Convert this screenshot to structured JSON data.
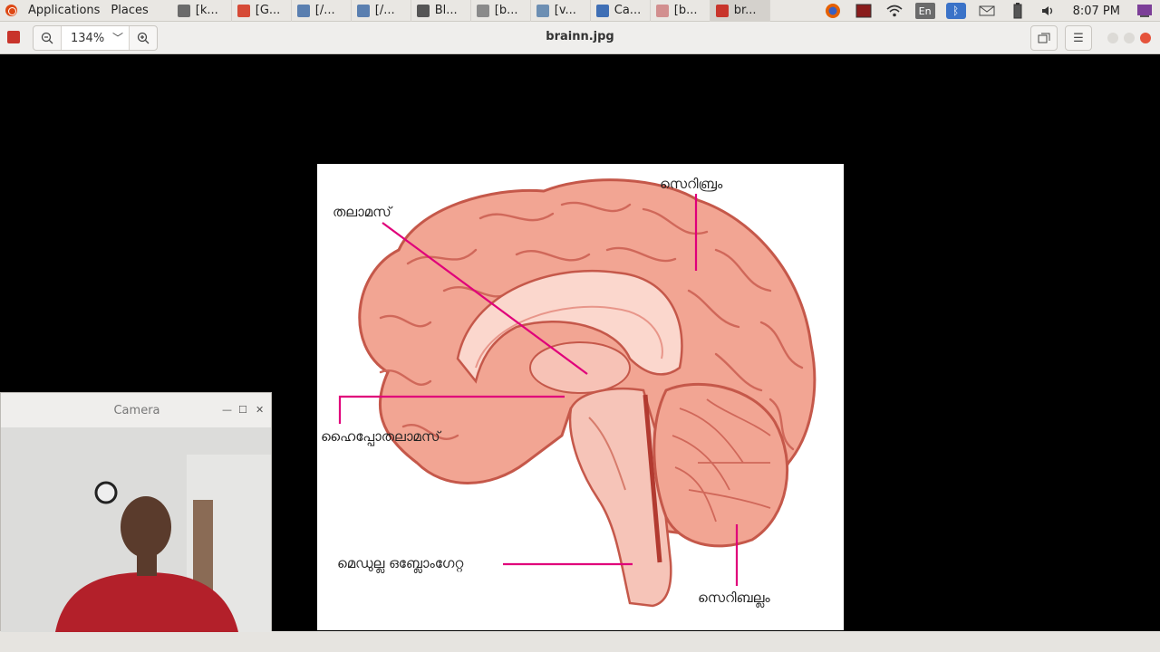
{
  "top_panel": {
    "applications_label": "Applications",
    "places_label": "Places",
    "tasks": [
      {
        "label": "[k...",
        "color": "#6b6b6b"
      },
      {
        "label": "[G...",
        "color": "#d64a36"
      },
      {
        "label": "[/...",
        "color": "#5a7fb0"
      },
      {
        "label": "[/...",
        "color": "#5a7fb0"
      },
      {
        "label": "Bl...",
        "color": "#555555"
      },
      {
        "label": "[b...",
        "color": "#8a8a8a"
      },
      {
        "label": "[v...",
        "color": "#6d8fb3"
      },
      {
        "label": "Ca...",
        "color": "#3f6fb5"
      },
      {
        "label": "[b...",
        "color": "#d28f8f"
      },
      {
        "label": "br...",
        "color": "#c8342b"
      }
    ],
    "active_task_index": 9,
    "clock": "8:07 PM",
    "keyboard_layout": "En"
  },
  "viewer": {
    "zoom_value": "134%",
    "title": "brainn.jpg"
  },
  "diagram": {
    "labels": {
      "thalamus": "തലാമസ്",
      "cerebrum": "സെറിബ്രം",
      "hypothalamus": "ഹൈപ്പോതലാമസ്",
      "medulla": "മെഡുല്ല ഒബ്ലോംഗേറ്റ",
      "cerebellum": "സെറിബല്ലം"
    }
  },
  "camera_window": {
    "title": "Camera"
  },
  "colors": {
    "leader_line": "#e0007a",
    "brain_fill": "#f2a593",
    "brain_stroke": "#c5584a"
  }
}
